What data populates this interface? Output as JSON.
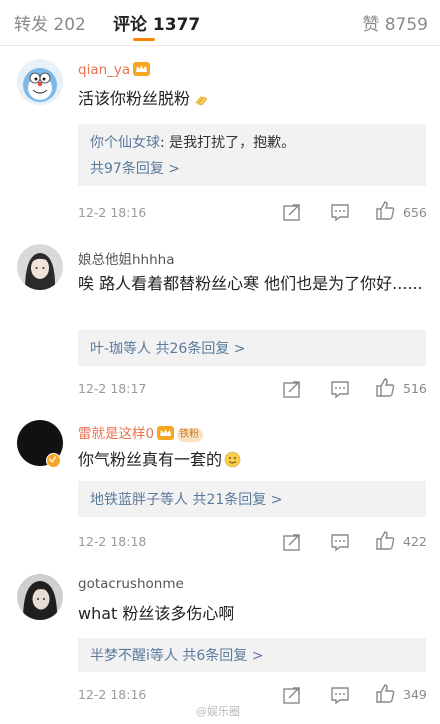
{
  "tabs": {
    "repost": "转发 202",
    "comments": "评论 1377",
    "likes": "赞 8759"
  },
  "comments": [
    {
      "username": "qian_ya",
      "user_color": "orange",
      "text": "活该你粉丝脱粉",
      "text_emoji": "clapping-hands-emoji",
      "badges": [
        "crown-icon"
      ],
      "reply": {
        "name": "你个仙女球",
        "content": ": 是我打扰了，抱歉。",
        "more": "共97条回复 >"
      },
      "time": "12-2 18:16",
      "likes": "656"
    },
    {
      "username": "娘总他姐hhhha",
      "user_color": "gray",
      "text": "唉 路人看着都替粉丝心寒 他们也是为了你好......",
      "reply": {
        "name": "叶-珈等人",
        "content": "",
        "more": " 共26条回复 >"
      },
      "time": "12-2 18:17",
      "likes": "516"
    },
    {
      "username": "雷就是这样0",
      "user_color": "orange",
      "text": "你气粉丝真有一套的",
      "text_emoji": "smile-emoji",
      "badges": [
        "crown-icon",
        "fan-badge"
      ],
      "fan_badge_text": "铁粉",
      "reply": {
        "name": "地铁蓝胖子等人",
        "content": "",
        "more": " 共21条回复 >"
      },
      "time": "12-2 18:18",
      "likes": "422"
    },
    {
      "username": "gotacrushonme",
      "user_color": "gray",
      "text": "what 粉丝该多伤心啊",
      "reply": {
        "name": "半梦不醒i等人",
        "content": "",
        "more": " 共6条回复 >"
      },
      "time": "12-2 18:16",
      "likes": "349"
    }
  ],
  "watermark": "@娱乐圈",
  "colors": {
    "accent": "#ff8200",
    "username_orange": "#eb7350",
    "reply_link": "#5b7a9e",
    "reply_bg": "#f2f2f2"
  }
}
